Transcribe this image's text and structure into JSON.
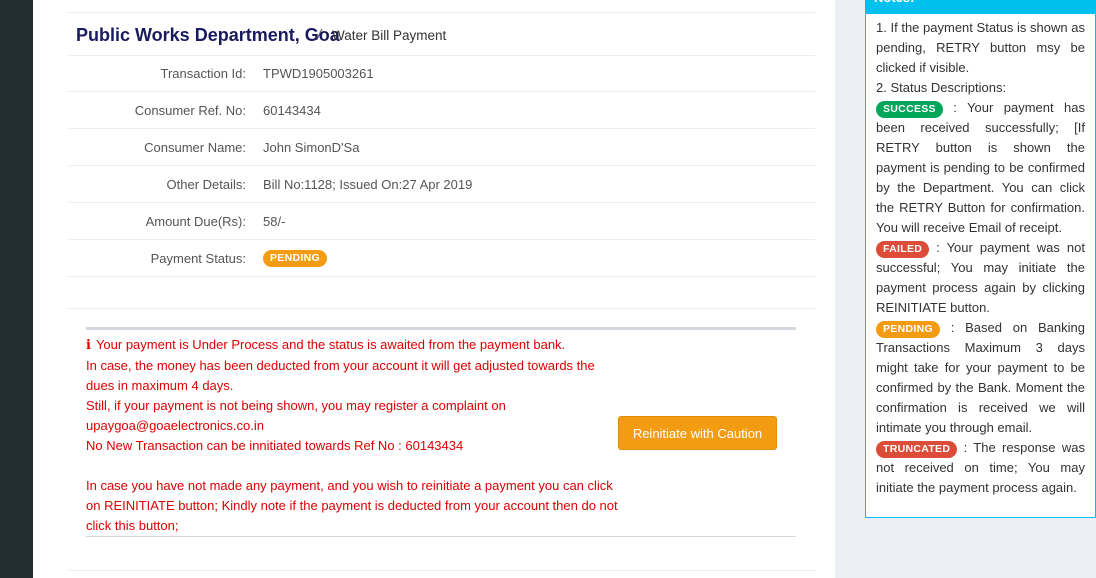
{
  "header": {
    "department": "Public Works Department, Goa",
    "separator": "/",
    "subtitle": "Water Bill Payment"
  },
  "details": [
    {
      "label": "Transaction Id:",
      "value": "TPWD1905003261"
    },
    {
      "label": "Consumer Ref. No:",
      "value": "60143434"
    },
    {
      "label": "Consumer Name:",
      "value": "John SimonD'Sa"
    },
    {
      "label": "Other Details:",
      "value": "Bill No:1128; Issued On:27 Apr 2019"
    },
    {
      "label": "Amount Due(Rs):",
      "value": "58/-"
    },
    {
      "label": "Payment Status:",
      "badge": "PENDING"
    }
  ],
  "message": {
    "icon": "info-icon",
    "line1": "Your payment is Under Process and the status is awaited from the payment bank.",
    "line2": "In case, the money has been deducted from your account it will get adjusted towards the dues in maximum 4 days.",
    "line3": "Still, if your payment is not being shown, you may register a complaint on upaygoa@goaelectronics.co.in",
    "line4": "No New Transaction can be innitiated towards Ref No : 60143434",
    "line5": "In case you have not made any payment, and you wish to reinitiate a payment you can click on REINITIATE button; Kindly note if the payment is deducted from your account then do not click this button;",
    "button": "Reinitiate with Caution"
  },
  "notes": {
    "title": "Notes:",
    "item1": "1. If the payment Status is shown as pending, RETRY button msy be clicked if visible.",
    "item2": "2. Status Descriptions:",
    "success_badge": "SUCCESS",
    "success_text": ": Your payment has been received successfully; [If RETRY button is shown the payment is pending to be confirmed by the Department. You can click the RETRY Button for confirmation. You will receive Email of receipt.",
    "failed_badge": "FAILED",
    "failed_text": ": Your payment was not successful; You may initiate the payment process again by clicking REINITIATE button.",
    "pending_badge": "PENDING",
    "pending_text": ": Based on Banking Transactions Maximum 3 days might take for your payment to be confirmed by the Bank. Moment the confirmation is received we will intimate you through email.",
    "truncated_badge": "TRUNCATED",
    "truncated_text": ": The response was not received on time; You may initiate the payment process again."
  },
  "colors": {
    "success": "#00a65a",
    "failed": "#dd4b39",
    "pending": "#f39c12",
    "info_border": "#00c0ef",
    "message_text": "#dd0000"
  }
}
